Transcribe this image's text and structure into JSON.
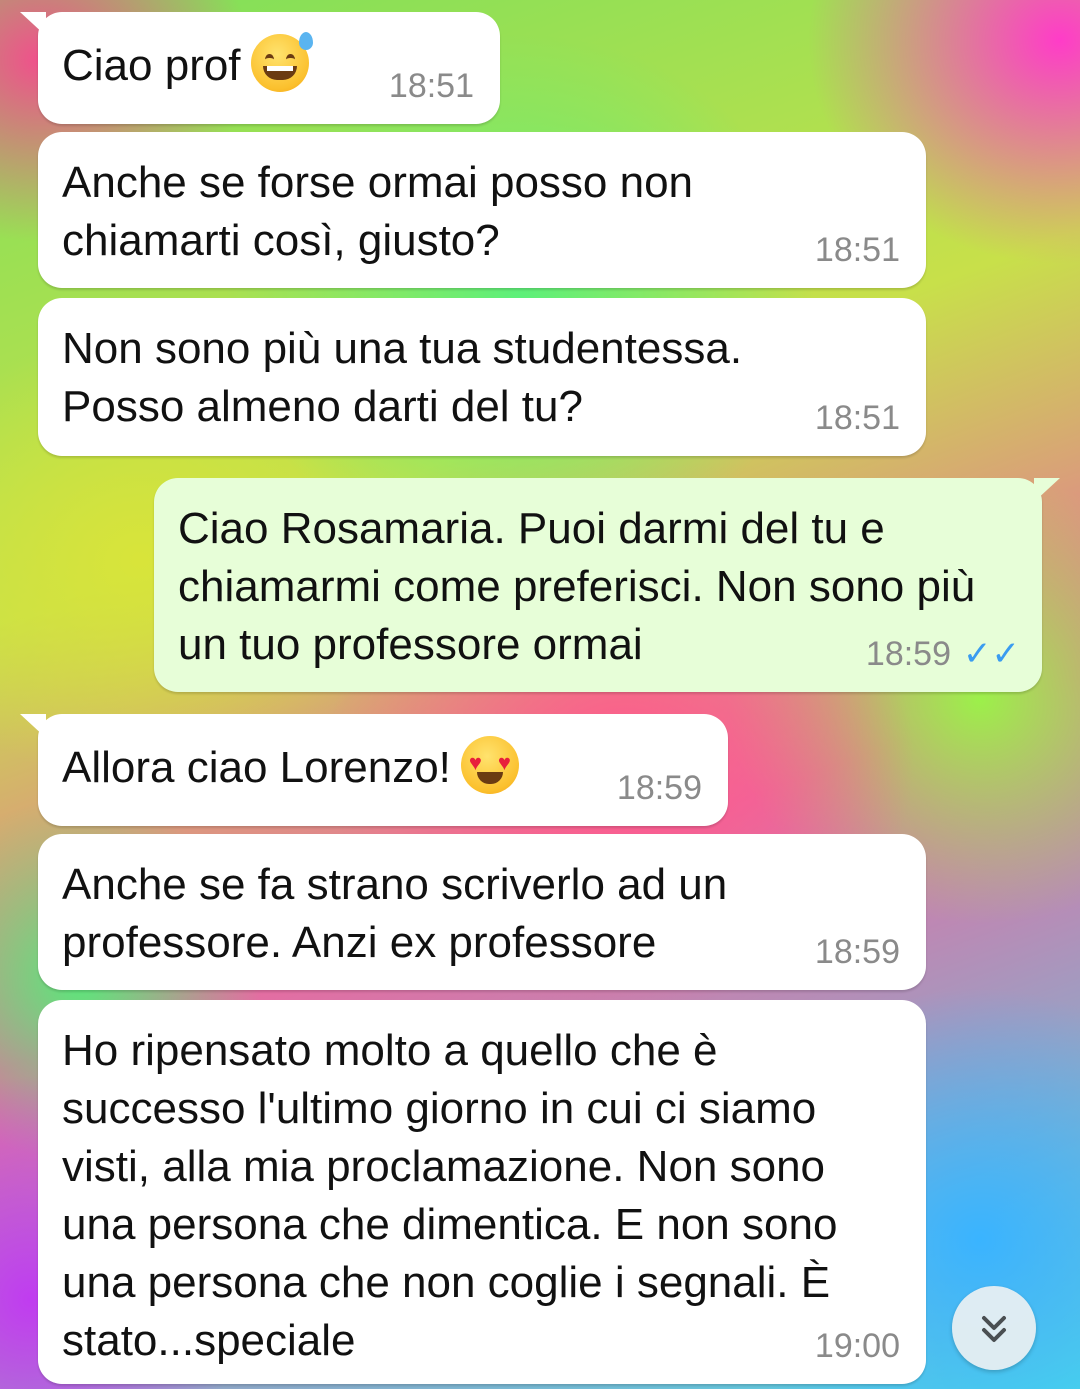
{
  "messages": [
    {
      "id": "m1",
      "direction": "incoming",
      "text": "Ciao prof",
      "emoji": "grinning-sweat-emoji",
      "time": "18:51"
    },
    {
      "id": "m2",
      "direction": "incoming",
      "text": "Anche se forse ormai posso non chiamarti così, giusto?",
      "time": "18:51"
    },
    {
      "id": "m3",
      "direction": "incoming",
      "text": "Non sono più una tua studentessa. Posso almeno darti del tu?",
      "time": "18:51"
    },
    {
      "id": "m4",
      "direction": "outgoing",
      "text": "Ciao Rosamaria. Puoi darmi del tu e chiamarmi come preferisci. Non sono più un tuo professore ormai",
      "time": "18:59",
      "status": "read-ticks-icon"
    },
    {
      "id": "m5",
      "direction": "incoming",
      "text": "Allora ciao Lorenzo!",
      "emoji": "heart-eyes-emoji",
      "time": "18:59"
    },
    {
      "id": "m6",
      "direction": "incoming",
      "text": "Anche se fa strano scriverlo ad un professore. Anzi ex professore",
      "time": "18:59"
    },
    {
      "id": "m7",
      "direction": "incoming",
      "text": "Ho ripensato molto a quello che è successo l'ultimo giorno in cui ci siamo visti, alla mia proclamazione. Non sono una persona che dimentica. E non sono una persona che non coglie i segnali. È stato...speciale",
      "time": "19:00"
    }
  ],
  "controls": {
    "scroll_down_icon": "double-chevron-down-icon"
  },
  "colors": {
    "incoming_bubble": "#ffffff",
    "outgoing_bubble": "#e7fed8",
    "read_ticks": "#3a9cf0",
    "timestamp": "#8a8a8a"
  }
}
